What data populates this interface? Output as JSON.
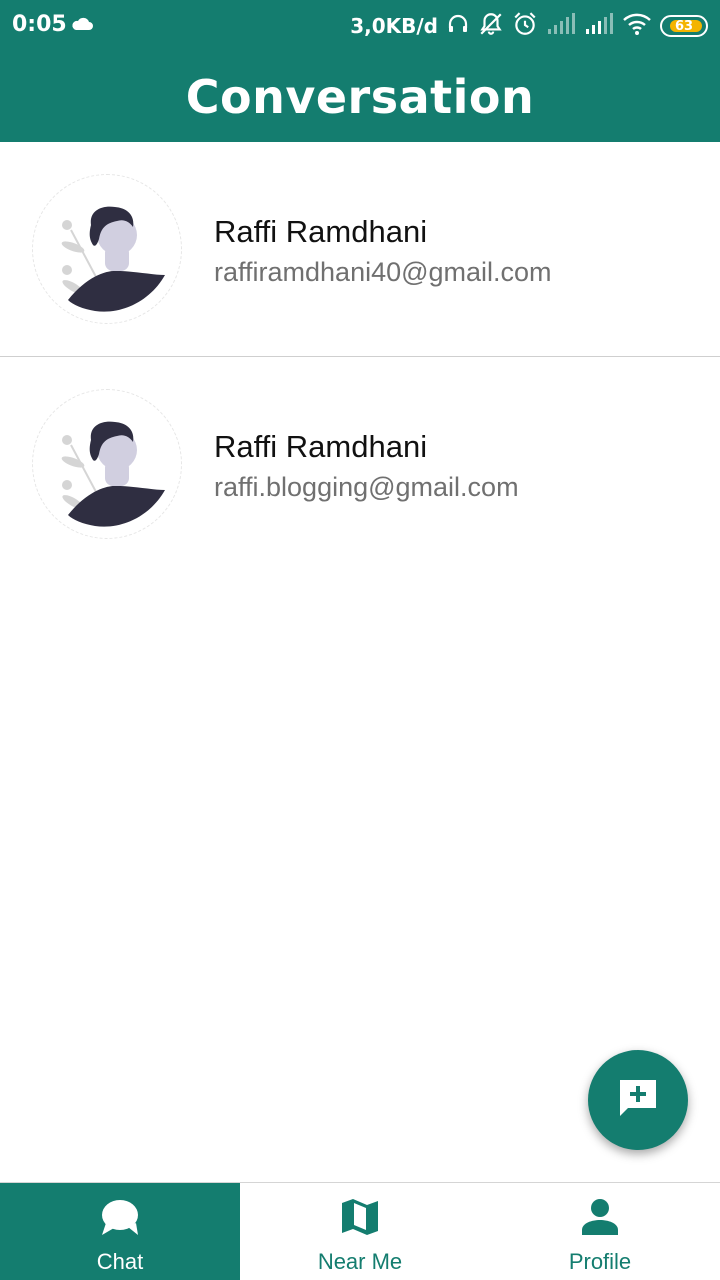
{
  "status_bar": {
    "time": "0:05",
    "net_speed": "3,0KB/d",
    "battery_level": "63",
    "icons": [
      "cloud-icon",
      "headset-icon",
      "bell-off-icon",
      "alarm-icon",
      "signal-icon",
      "signal-icon",
      "wifi-icon",
      "battery-icon"
    ]
  },
  "app_bar": {
    "title": "Conversation"
  },
  "conversations": [
    {
      "name": "Raffi Ramdhani",
      "email": "raffiramdhani40@gmail.com"
    },
    {
      "name": "Raffi Ramdhani",
      "email": "raffi.blogging@gmail.com"
    }
  ],
  "fab": {
    "icon": "new-chat-icon"
  },
  "bottom_nav": {
    "items": [
      {
        "label": "Chat",
        "icon": "chat-icon",
        "active": true
      },
      {
        "label": "Near Me",
        "icon": "map-icon",
        "active": false
      },
      {
        "label": "Profile",
        "icon": "person-icon",
        "active": false
      }
    ]
  },
  "colors": {
    "primary": "#147d6f",
    "battery": "#f4b400",
    "email_text": "#707070"
  }
}
